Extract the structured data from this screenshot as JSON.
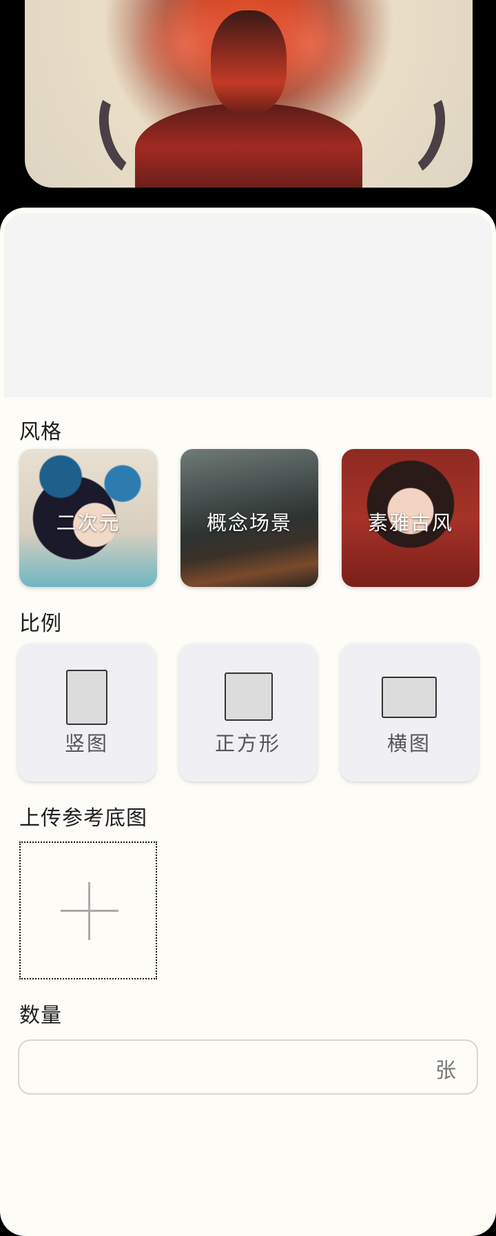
{
  "sections": {
    "style": "风格",
    "ratio": "比例",
    "upload": "上传参考底图",
    "quantity": "数量"
  },
  "styles": [
    {
      "label": "二次元"
    },
    {
      "label": "概念场景"
    },
    {
      "label": "素雅古风"
    }
  ],
  "ratios": [
    {
      "label": "竖图",
      "icon": "portrait-ratio-icon"
    },
    {
      "label": "正方形",
      "icon": "square-ratio-icon"
    },
    {
      "label": "横图",
      "icon": "landscape-ratio-icon"
    }
  ],
  "quantity": {
    "value": "",
    "unit": "张"
  }
}
